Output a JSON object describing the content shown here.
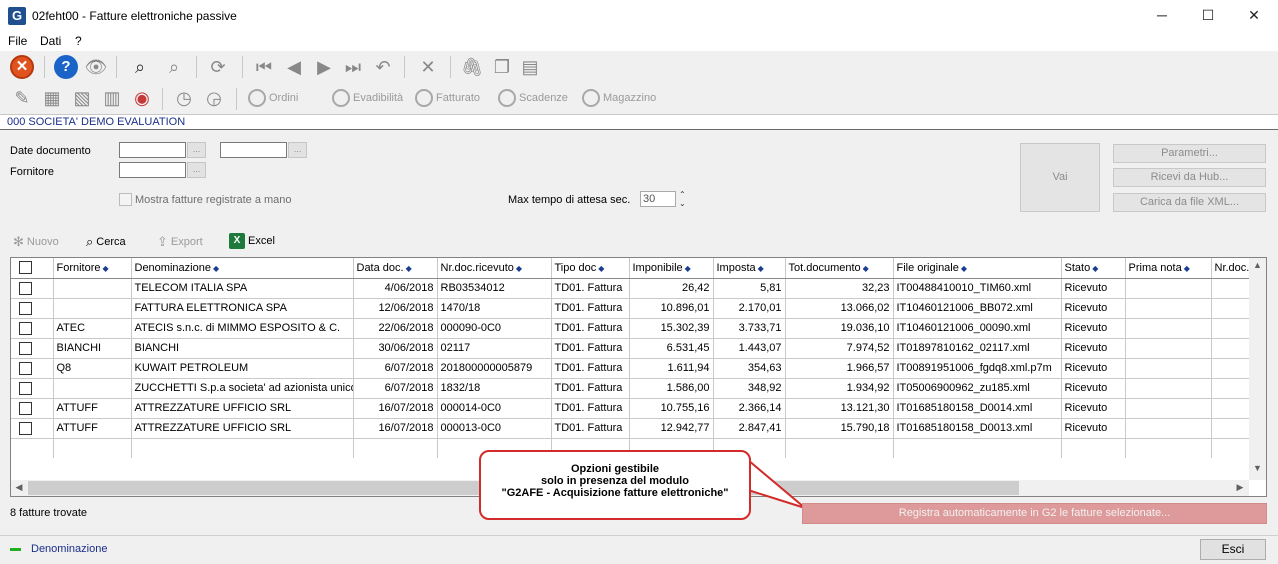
{
  "window": {
    "title": "02feht00 - Fatture elettroniche passive",
    "logo": "G",
    "controls": {
      "minimize": "─",
      "maximize": "☐",
      "close": "✕"
    }
  },
  "menu": [
    "File",
    "Dati",
    "?"
  ],
  "toolbar2": {
    "ordini": "Ordini",
    "evadibilita": "Evadibilità",
    "fatturato": "Fatturato",
    "scadenze": "Scadenze",
    "magazzino": "Magazzino"
  },
  "company": "000 SOCIETA'  DEMO EVALUATION",
  "filters": {
    "date_label": "Date documento",
    "supplier_label": "Fornitore",
    "date_from": "",
    "date_to": "",
    "supplier": "",
    "dots": "...",
    "manual_label": "Mostra fatture registrate a mano",
    "max_wait_label": "Max tempo di attesa sec.",
    "max_wait_value": "30"
  },
  "actions": {
    "vai": "Vai",
    "parametri": "Parametri...",
    "ricevi": "Ricevi da Hub...",
    "carica": "Carica da file XML..."
  },
  "grid_toolbar": {
    "nuovo": "Nuovo",
    "cerca": "Cerca",
    "export": "Export",
    "excel": "Excel"
  },
  "columns": [
    "Fornitore",
    "Denominazione",
    "Data doc.",
    "Nr.doc.ricevuto",
    "Tipo doc",
    "Imponibile",
    "Imposta",
    "Tot.documento",
    "File originale",
    "Stato",
    "Prima nota",
    "Nr.doc."
  ],
  "rows": [
    [
      "",
      "TELECOM ITALIA SPA",
      "4/06/2018",
      "RB03534012",
      "TD01. Fattura",
      "26,42",
      "5,81",
      "32,23",
      "IT00488410010_TIM60.xml",
      "Ricevuto",
      "",
      ""
    ],
    [
      "",
      "FATTURA ELETTRONICA SPA",
      "12/06/2018",
      "1470/18",
      "TD01. Fattura",
      "10.896,01",
      "2.170,01",
      "13.066,02",
      "IT10460121006_BB072.xml",
      "Ricevuto",
      "",
      ""
    ],
    [
      "ATEC",
      "ATECIS s.n.c. di MIMMO ESPOSITO & C.",
      "22/06/2018",
      "000090-0C0",
      "TD01. Fattura",
      "15.302,39",
      "3.733,71",
      "19.036,10",
      "IT10460121006_00090.xml",
      "Ricevuto",
      "",
      ""
    ],
    [
      "BIANCHI",
      "BIANCHI",
      "30/06/2018",
      "02117",
      "TD01. Fattura",
      "6.531,45",
      "1.443,07",
      "7.974,52",
      "IT01897810162_02117.xml",
      "Ricevuto",
      "",
      ""
    ],
    [
      "Q8",
      "KUWAIT PETROLEUM",
      "6/07/2018",
      "201800000005879",
      "TD01. Fattura",
      "1.611,94",
      "354,63",
      "1.966,57",
      "IT00891951006_fgdq8.xml.p7m",
      "Ricevuto",
      "",
      ""
    ],
    [
      "",
      "ZUCCHETTI S.p.a societa' ad azionista unico",
      "6/07/2018",
      "1832/18",
      "TD01. Fattura",
      "1.586,00",
      "348,92",
      "1.934,92",
      "IT05006900962_zu185.xml",
      "Ricevuto",
      "",
      ""
    ],
    [
      "ATTUFF",
      "ATTREZZATURE  UFFICIO SRL",
      "16/07/2018",
      "000014-0C0",
      "TD01. Fattura",
      "10.755,16",
      "2.366,14",
      "13.121,30",
      "IT01685180158_D0014.xml",
      "Ricevuto",
      "",
      ""
    ],
    [
      "ATTUFF",
      "ATTREZZATURE  UFFICIO SRL",
      "16/07/2018",
      "000013-0C0",
      "TD01. Fattura",
      "12.942,77",
      "2.847,41",
      "15.790,18",
      "IT01685180158_D0013.xml",
      "Ricevuto",
      "",
      ""
    ]
  ],
  "status": "8 fatture trovate",
  "callout": {
    "line1": "Opzioni gestibile",
    "line2": "solo in presenza del modulo",
    "line3": "\"G2AFE - Acquisizione fatture elettroniche\""
  },
  "register_button": "Registra automaticamente in G2 le fatture selezionate...",
  "legend": "Denominazione",
  "exit": "Esci",
  "colors": {
    "accent": "#1a2f8a",
    "callout_border": "#d32a2a",
    "register_bg": "#de9a9a",
    "legend": "#20b020"
  }
}
